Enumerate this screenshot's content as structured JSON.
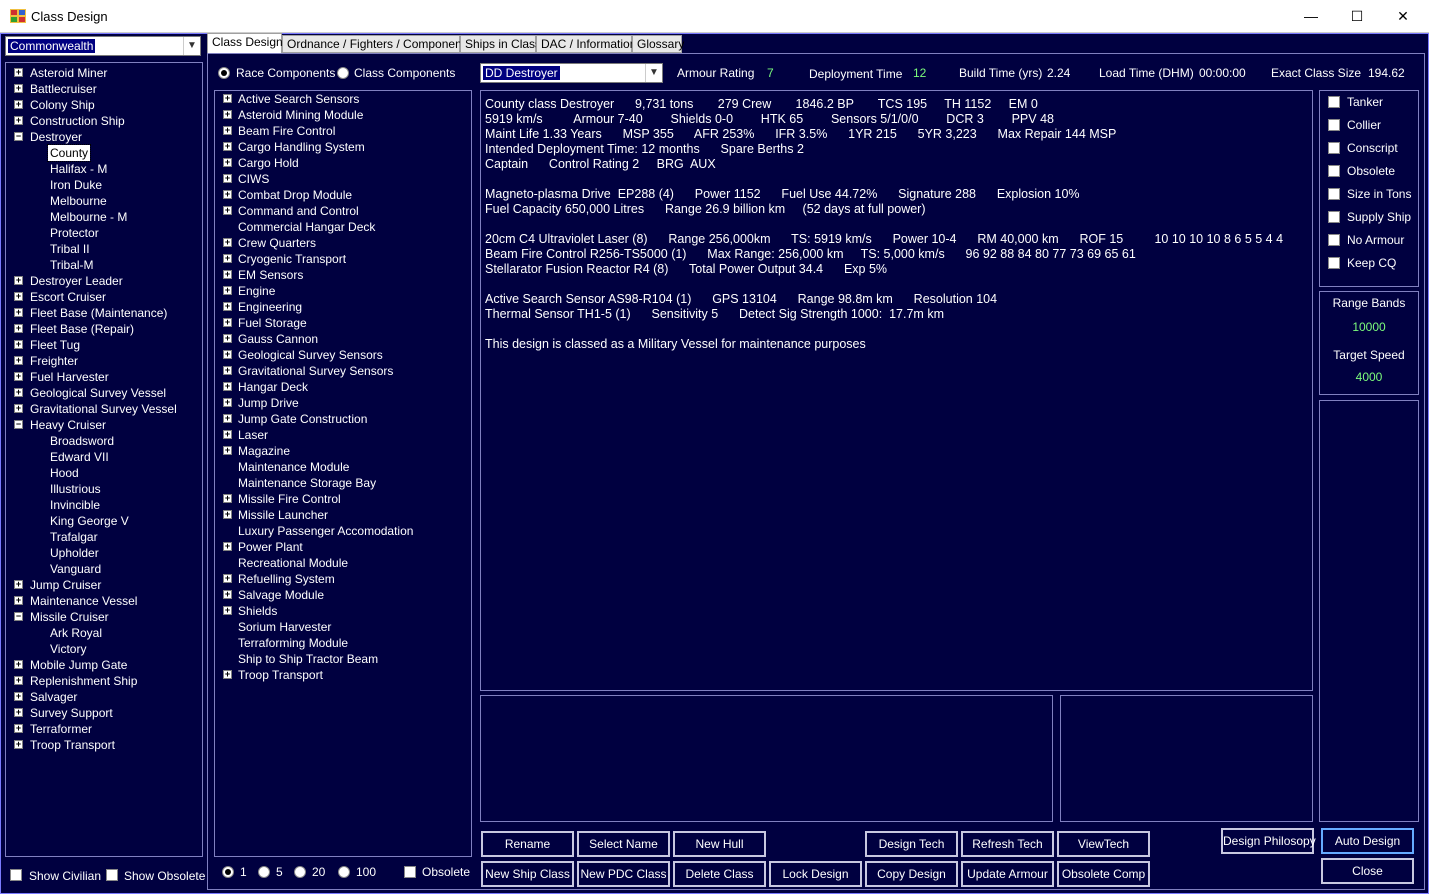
{
  "window": {
    "title": "Class Design",
    "minimize": "—",
    "maximize": "☐",
    "close": "✕"
  },
  "race_select": {
    "value": "Commonwealth"
  },
  "tabs": [
    {
      "label": "Class Design",
      "active": true
    },
    {
      "label": "Ordnance / Fighters / Components"
    },
    {
      "label": "Ships in Class"
    },
    {
      "label": "DAC / Information"
    },
    {
      "label": "Glossary"
    }
  ],
  "class_tree": [
    {
      "label": "Asteroid Miner",
      "type": "group"
    },
    {
      "label": "Battlecruiser",
      "type": "group"
    },
    {
      "label": "Colony Ship",
      "type": "group"
    },
    {
      "label": "Construction Ship",
      "type": "group"
    },
    {
      "label": "Destroyer",
      "type": "group",
      "expanded": true
    },
    {
      "label": "County",
      "type": "child",
      "selected": true
    },
    {
      "label": "Halifax - M",
      "type": "child"
    },
    {
      "label": "Iron Duke",
      "type": "child"
    },
    {
      "label": "Melbourne",
      "type": "child"
    },
    {
      "label": "Melbourne - M",
      "type": "child"
    },
    {
      "label": "Protector",
      "type": "child"
    },
    {
      "label": "Tribal II",
      "type": "child"
    },
    {
      "label": "Tribal-M",
      "type": "child"
    },
    {
      "label": "Destroyer Leader",
      "type": "group"
    },
    {
      "label": "Escort Cruiser",
      "type": "group"
    },
    {
      "label": "Fleet Base (Maintenance)",
      "type": "group"
    },
    {
      "label": "Fleet Base (Repair)",
      "type": "group"
    },
    {
      "label": "Fleet Tug",
      "type": "group"
    },
    {
      "label": "Freighter",
      "type": "group"
    },
    {
      "label": "Fuel Harvester",
      "type": "group"
    },
    {
      "label": "Geological Survey Vessel",
      "type": "group"
    },
    {
      "label": "Gravitational Survey Vessel",
      "type": "group"
    },
    {
      "label": "Heavy Cruiser",
      "type": "group",
      "expanded": true
    },
    {
      "label": "Broadsword",
      "type": "child"
    },
    {
      "label": "Edward VII",
      "type": "child"
    },
    {
      "label": "Hood",
      "type": "child"
    },
    {
      "label": "Illustrious",
      "type": "child"
    },
    {
      "label": "Invincible",
      "type": "child"
    },
    {
      "label": "King George V",
      "type": "child"
    },
    {
      "label": "Trafalgar",
      "type": "child"
    },
    {
      "label": "Upholder",
      "type": "child"
    },
    {
      "label": "Vanguard",
      "type": "child"
    },
    {
      "label": "Jump Cruiser",
      "type": "group"
    },
    {
      "label": "Maintenance Vessel",
      "type": "group"
    },
    {
      "label": "Missile Cruiser",
      "type": "group",
      "expanded": true
    },
    {
      "label": "Ark Royal",
      "type": "child"
    },
    {
      "label": "Victory",
      "type": "child"
    },
    {
      "label": "Mobile Jump Gate",
      "type": "group"
    },
    {
      "label": "Replenishment Ship",
      "type": "group"
    },
    {
      "label": "Salvager",
      "type": "group"
    },
    {
      "label": "Survey Support",
      "type": "group"
    },
    {
      "label": "Terraformer",
      "type": "group"
    },
    {
      "label": "Troop Transport",
      "type": "group"
    }
  ],
  "left_bottom": {
    "show_civilian": "Show Civilian",
    "show_obsolete": "Show Obsolete"
  },
  "component_mode": {
    "race": "Race Components",
    "class": "Class Components",
    "selected": "race"
  },
  "component_tree": [
    {
      "label": "Active Search Sensors",
      "expandable": true
    },
    {
      "label": "Asteroid Mining Module",
      "expandable": true
    },
    {
      "label": "Beam Fire Control",
      "expandable": true
    },
    {
      "label": "Cargo Handling System",
      "expandable": true
    },
    {
      "label": "Cargo Hold",
      "expandable": true
    },
    {
      "label": "CIWS",
      "expandable": true
    },
    {
      "label": "Combat Drop Module",
      "expandable": true
    },
    {
      "label": "Command and Control",
      "expandable": true
    },
    {
      "label": "Commercial Hangar Deck",
      "expandable": false
    },
    {
      "label": "Crew Quarters",
      "expandable": true
    },
    {
      "label": "Cryogenic Transport",
      "expandable": true
    },
    {
      "label": "EM Sensors",
      "expandable": true
    },
    {
      "label": "Engine",
      "expandable": true
    },
    {
      "label": "Engineering",
      "expandable": true
    },
    {
      "label": "Fuel Storage",
      "expandable": true
    },
    {
      "label": "Gauss Cannon",
      "expandable": true
    },
    {
      "label": "Geological Survey Sensors",
      "expandable": true
    },
    {
      "label": "Gravitational Survey Sensors",
      "expandable": true
    },
    {
      "label": "Hangar Deck",
      "expandable": true
    },
    {
      "label": "Jump Drive",
      "expandable": true
    },
    {
      "label": "Jump Gate Construction",
      "expandable": true
    },
    {
      "label": "Laser",
      "expandable": true
    },
    {
      "label": "Magazine",
      "expandable": true
    },
    {
      "label": "Maintenance Module",
      "expandable": false
    },
    {
      "label": "Maintenance Storage Bay",
      "expandable": false
    },
    {
      "label": "Missile Fire Control",
      "expandable": true
    },
    {
      "label": "Missile Launcher",
      "expandable": true
    },
    {
      "label": "Luxury Passenger Accomodation",
      "expandable": false
    },
    {
      "label": "Power Plant",
      "expandable": true
    },
    {
      "label": "Recreational Module",
      "expandable": false
    },
    {
      "label": "Refuelling System",
      "expandable": true
    },
    {
      "label": "Salvage Module",
      "expandable": true
    },
    {
      "label": "Shields",
      "expandable": true
    },
    {
      "label": "Sorium Harvester",
      "expandable": false
    },
    {
      "label": "Terraforming Module",
      "expandable": false
    },
    {
      "label": "Ship to Ship Tractor Beam",
      "expandable": false
    },
    {
      "label": "Troop Transport",
      "expandable": true
    }
  ],
  "quantity_options": {
    "options": [
      "1",
      "5",
      "20",
      "100"
    ],
    "selected": "1",
    "obsolete": "Obsolete"
  },
  "header": {
    "class_select": "DD Destroyer",
    "armour_rating_label": "Armour Rating",
    "armour_rating": "7",
    "deployment_time_label": "Deployment Time",
    "deployment_time": "12",
    "build_time_label": "Build Time (yrs)",
    "build_time": "2.24",
    "load_time_label": "Load Time (DHM)",
    "load_time": "00:00:00",
    "exact_size_label": "Exact Class Size",
    "exact_size": "194.62"
  },
  "design_summary": [
    "County class Destroyer      9,731 tons       279 Crew       1846.2 BP       TCS 195     TH 1152     EM 0",
    "5919 km/s         Armour 7-40        Shields 0-0        HTK 65        Sensors 5/1/0/0        DCR 3        PPV 48",
    "Maint Life 1.33 Years      MSP 355      AFR 253%      IFR 3.5%      1YR 215      5YR 3,223      Max Repair 144 MSP",
    "Intended Deployment Time: 12 months      Spare Berths 2",
    "Captain      Control Rating 2     BRG  AUX",
    "",
    "Magneto-plasma Drive  EP288 (4)      Power 1152      Fuel Use 44.72%      Signature 288      Explosion 10%",
    "Fuel Capacity 650,000 Litres      Range 26.9 billion km     (52 days at full power)",
    "",
    "20cm C4 Ultraviolet Laser (8)      Range 256,000km      TS: 5919 km/s      Power 10-4      RM 40,000 km      ROF 15         10 10 10 10 8 6 5 5 4 4",
    "Beam Fire Control R256-TS5000 (1)      Max Range: 256,000 km     TS: 5,000 km/s      96 92 88 84 80 77 73 69 65 61",
    "Stellarator Fusion Reactor R4 (8)      Total Power Output 34.4      Exp 5%",
    "",
    "Active Search Sensor AS98-R104 (1)      GPS 13104      Range 98.8m km      Resolution 104",
    "Thermal Sensor TH1-5 (1)      Sensitivity 5      Detect Sig Strength 1000:  17.7m km",
    "",
    "This design is classed as a Military Vessel for maintenance purposes"
  ],
  "flags": [
    "Tanker",
    "Collier",
    "Conscript",
    "Obsolete",
    "Size in Tons",
    "Supply Ship",
    "No Armour",
    "Keep CQ"
  ],
  "range_bands": {
    "label": "Range Bands",
    "value": "10000",
    "target_speed_label": "Target Speed",
    "target_speed": "4000"
  },
  "buttons": {
    "rename": "Rename",
    "select_name": "Select Name",
    "new_hull": "New Hull",
    "design_tech": "Design Tech",
    "refresh_tech": "Refresh Tech",
    "view_tech": "ViewTech",
    "new_ship_class": "New Ship Class",
    "new_pdc_class": "New PDC Class",
    "delete_class": "Delete Class",
    "lock_design": "Lock Design",
    "copy_design": "Copy Design",
    "update_armour": "Update Armour",
    "obsolete_comp": "Obsolete Comp",
    "design_philosophy": "Design Philosopy",
    "auto_design": "Auto Design",
    "close": "Close"
  },
  "colors": {
    "background": "#000040",
    "value_green": "#7cfc7c",
    "border": "#8080c0"
  }
}
